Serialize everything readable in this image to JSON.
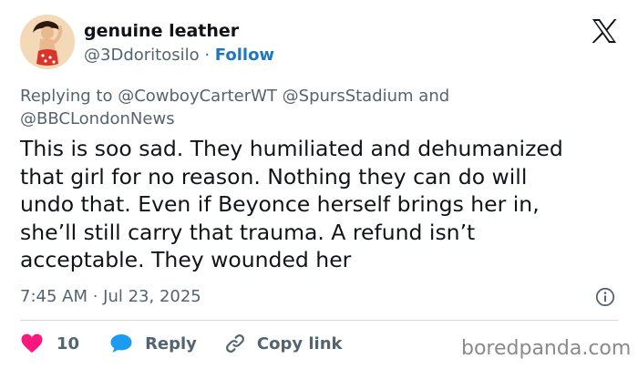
{
  "user": {
    "display_name": "genuine leather",
    "handle": "@3Ddoritosilo",
    "separator": " · ",
    "follow_label": "Follow"
  },
  "reply_context": {
    "prefix": "Replying to ",
    "mention_1": "@CowboyCarterWT",
    "mention_2": "@SpursStadium",
    "joiner": " and",
    "mention_3": "@BBCLondonNews"
  },
  "tweet": {
    "text": "This is soo sad. They humiliated and dehumanized\nthat girl for no reason. Nothing they can do will\nundo that. Even if Beyonce herself brings her in,\nshe’ll still carry that trauma. A refund isn’t\nacceptable. They wounded her",
    "timestamp": "7:45 AM · Jul 23, 2025"
  },
  "actions": {
    "like_count": "10",
    "reply_label": "Reply",
    "copy_link_label": "Copy link"
  },
  "watermark": "boredpanda.com",
  "icons": {
    "brand": "x-logo-icon",
    "info": "info-icon",
    "like": "heart-icon",
    "reply": "speech-bubble-icon",
    "copy_link": "link-icon"
  },
  "colors": {
    "follow": "#1d77c2",
    "heart": "#f91880",
    "reply_bubble": "#1d9bf0",
    "secondary_text": "#536471",
    "primary_text": "#0f1419"
  }
}
